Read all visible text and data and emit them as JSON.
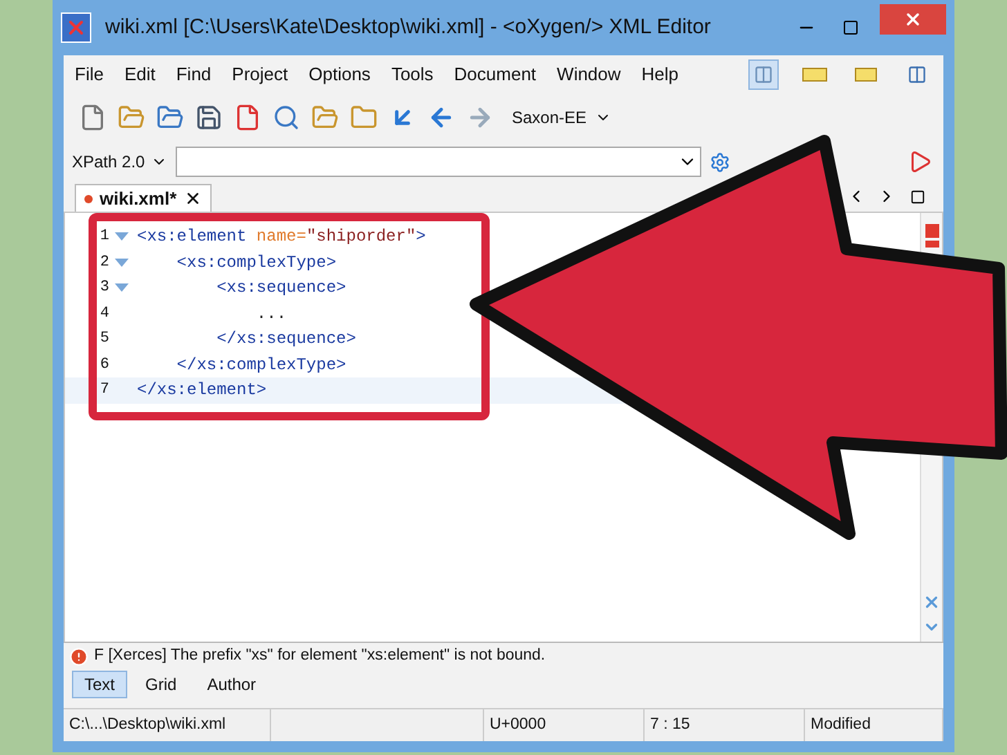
{
  "window": {
    "title": "wiki.xml [C:\\Users\\Kate\\Desktop\\wiki.xml] - <oXygen/> XML Editor"
  },
  "menu": [
    "File",
    "Edit",
    "Find",
    "Project",
    "Options",
    "Tools",
    "Document",
    "Window",
    "Help"
  ],
  "toolbar": {
    "transformer": "Saxon-EE"
  },
  "xpath": {
    "version": "XPath 2.0"
  },
  "editor_tab": {
    "label": "wiki.xml*",
    "modified": true
  },
  "code_lines": [
    {
      "number": "1",
      "foldable": true,
      "current": false,
      "tokens": [
        {
          "kind": "tag",
          "text": "<xs:element"
        },
        {
          "kind": "attr",
          "text": " name="
        },
        {
          "kind": "value",
          "text": "\"shiporder\""
        },
        {
          "kind": "tag",
          "text": ">"
        }
      ]
    },
    {
      "number": "2",
      "foldable": true,
      "current": false,
      "tokens": [
        {
          "kind": "tag",
          "text": "    <xs:complexType>"
        }
      ]
    },
    {
      "number": "3",
      "foldable": true,
      "current": false,
      "tokens": [
        {
          "kind": "tag",
          "text": "        <xs:sequence>"
        }
      ]
    },
    {
      "number": "4",
      "foldable": false,
      "current": false,
      "tokens": [
        {
          "kind": "text",
          "text": "            ..."
        }
      ]
    },
    {
      "number": "5",
      "foldable": false,
      "current": false,
      "tokens": [
        {
          "kind": "tag",
          "text": "        </xs:sequence>"
        }
      ]
    },
    {
      "number": "6",
      "foldable": false,
      "current": false,
      "tokens": [
        {
          "kind": "tag",
          "text": "    </xs:complexType>"
        }
      ]
    },
    {
      "number": "7",
      "foldable": false,
      "current": true,
      "tokens": [
        {
          "kind": "tag",
          "text": "</xs:element>"
        }
      ]
    }
  ],
  "message": "F [Xerces] The prefix \"xs\" for element \"xs:element\" is not bound.",
  "view_tabs": [
    {
      "label": "Text",
      "selected": true
    },
    {
      "label": "Grid",
      "selected": false
    },
    {
      "label": "Author",
      "selected": false
    }
  ],
  "status_bar": [
    "C:\\...\\Desktop\\wiki.xml",
    "U+0000",
    "7 : 15",
    "Modified"
  ]
}
